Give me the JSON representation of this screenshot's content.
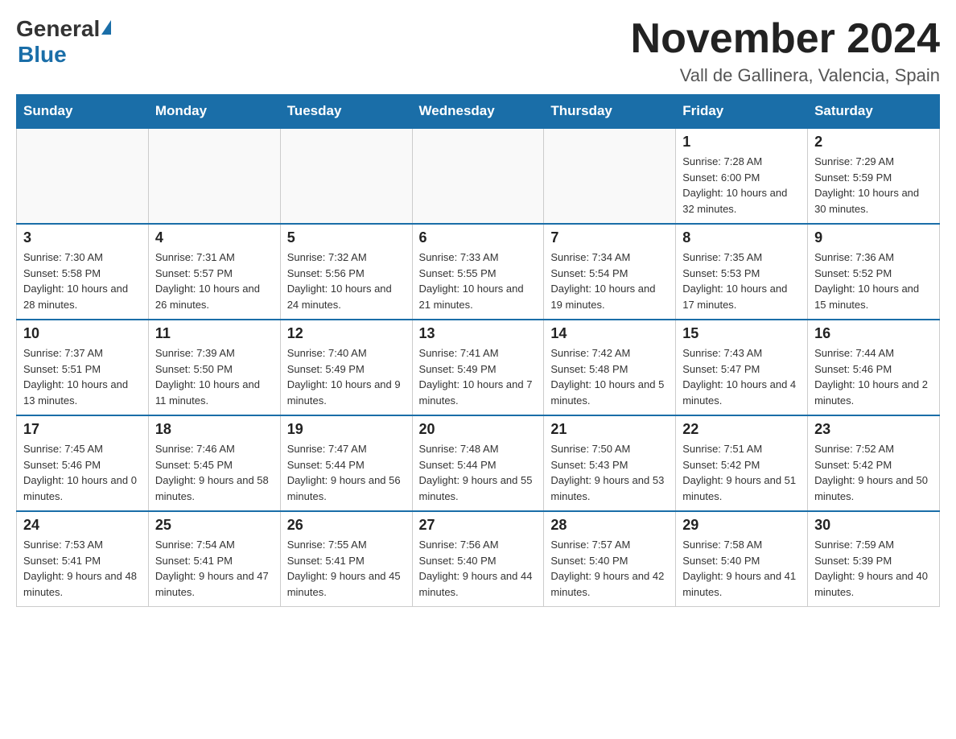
{
  "header": {
    "logo_general": "General",
    "logo_blue": "Blue",
    "month_title": "November 2024",
    "subtitle": "Vall de Gallinera, Valencia, Spain"
  },
  "days_of_week": [
    "Sunday",
    "Monday",
    "Tuesday",
    "Wednesday",
    "Thursday",
    "Friday",
    "Saturday"
  ],
  "weeks": [
    [
      {
        "day": "",
        "info": ""
      },
      {
        "day": "",
        "info": ""
      },
      {
        "day": "",
        "info": ""
      },
      {
        "day": "",
        "info": ""
      },
      {
        "day": "",
        "info": ""
      },
      {
        "day": "1",
        "info": "Sunrise: 7:28 AM\nSunset: 6:00 PM\nDaylight: 10 hours and 32 minutes."
      },
      {
        "day": "2",
        "info": "Sunrise: 7:29 AM\nSunset: 5:59 PM\nDaylight: 10 hours and 30 minutes."
      }
    ],
    [
      {
        "day": "3",
        "info": "Sunrise: 7:30 AM\nSunset: 5:58 PM\nDaylight: 10 hours and 28 minutes."
      },
      {
        "day": "4",
        "info": "Sunrise: 7:31 AM\nSunset: 5:57 PM\nDaylight: 10 hours and 26 minutes."
      },
      {
        "day": "5",
        "info": "Sunrise: 7:32 AM\nSunset: 5:56 PM\nDaylight: 10 hours and 24 minutes."
      },
      {
        "day": "6",
        "info": "Sunrise: 7:33 AM\nSunset: 5:55 PM\nDaylight: 10 hours and 21 minutes."
      },
      {
        "day": "7",
        "info": "Sunrise: 7:34 AM\nSunset: 5:54 PM\nDaylight: 10 hours and 19 minutes."
      },
      {
        "day": "8",
        "info": "Sunrise: 7:35 AM\nSunset: 5:53 PM\nDaylight: 10 hours and 17 minutes."
      },
      {
        "day": "9",
        "info": "Sunrise: 7:36 AM\nSunset: 5:52 PM\nDaylight: 10 hours and 15 minutes."
      }
    ],
    [
      {
        "day": "10",
        "info": "Sunrise: 7:37 AM\nSunset: 5:51 PM\nDaylight: 10 hours and 13 minutes."
      },
      {
        "day": "11",
        "info": "Sunrise: 7:39 AM\nSunset: 5:50 PM\nDaylight: 10 hours and 11 minutes."
      },
      {
        "day": "12",
        "info": "Sunrise: 7:40 AM\nSunset: 5:49 PM\nDaylight: 10 hours and 9 minutes."
      },
      {
        "day": "13",
        "info": "Sunrise: 7:41 AM\nSunset: 5:49 PM\nDaylight: 10 hours and 7 minutes."
      },
      {
        "day": "14",
        "info": "Sunrise: 7:42 AM\nSunset: 5:48 PM\nDaylight: 10 hours and 5 minutes."
      },
      {
        "day": "15",
        "info": "Sunrise: 7:43 AM\nSunset: 5:47 PM\nDaylight: 10 hours and 4 minutes."
      },
      {
        "day": "16",
        "info": "Sunrise: 7:44 AM\nSunset: 5:46 PM\nDaylight: 10 hours and 2 minutes."
      }
    ],
    [
      {
        "day": "17",
        "info": "Sunrise: 7:45 AM\nSunset: 5:46 PM\nDaylight: 10 hours and 0 minutes."
      },
      {
        "day": "18",
        "info": "Sunrise: 7:46 AM\nSunset: 5:45 PM\nDaylight: 9 hours and 58 minutes."
      },
      {
        "day": "19",
        "info": "Sunrise: 7:47 AM\nSunset: 5:44 PM\nDaylight: 9 hours and 56 minutes."
      },
      {
        "day": "20",
        "info": "Sunrise: 7:48 AM\nSunset: 5:44 PM\nDaylight: 9 hours and 55 minutes."
      },
      {
        "day": "21",
        "info": "Sunrise: 7:50 AM\nSunset: 5:43 PM\nDaylight: 9 hours and 53 minutes."
      },
      {
        "day": "22",
        "info": "Sunrise: 7:51 AM\nSunset: 5:42 PM\nDaylight: 9 hours and 51 minutes."
      },
      {
        "day": "23",
        "info": "Sunrise: 7:52 AM\nSunset: 5:42 PM\nDaylight: 9 hours and 50 minutes."
      }
    ],
    [
      {
        "day": "24",
        "info": "Sunrise: 7:53 AM\nSunset: 5:41 PM\nDaylight: 9 hours and 48 minutes."
      },
      {
        "day": "25",
        "info": "Sunrise: 7:54 AM\nSunset: 5:41 PM\nDaylight: 9 hours and 47 minutes."
      },
      {
        "day": "26",
        "info": "Sunrise: 7:55 AM\nSunset: 5:41 PM\nDaylight: 9 hours and 45 minutes."
      },
      {
        "day": "27",
        "info": "Sunrise: 7:56 AM\nSunset: 5:40 PM\nDaylight: 9 hours and 44 minutes."
      },
      {
        "day": "28",
        "info": "Sunrise: 7:57 AM\nSunset: 5:40 PM\nDaylight: 9 hours and 42 minutes."
      },
      {
        "day": "29",
        "info": "Sunrise: 7:58 AM\nSunset: 5:40 PM\nDaylight: 9 hours and 41 minutes."
      },
      {
        "day": "30",
        "info": "Sunrise: 7:59 AM\nSunset: 5:39 PM\nDaylight: 9 hours and 40 minutes."
      }
    ]
  ]
}
